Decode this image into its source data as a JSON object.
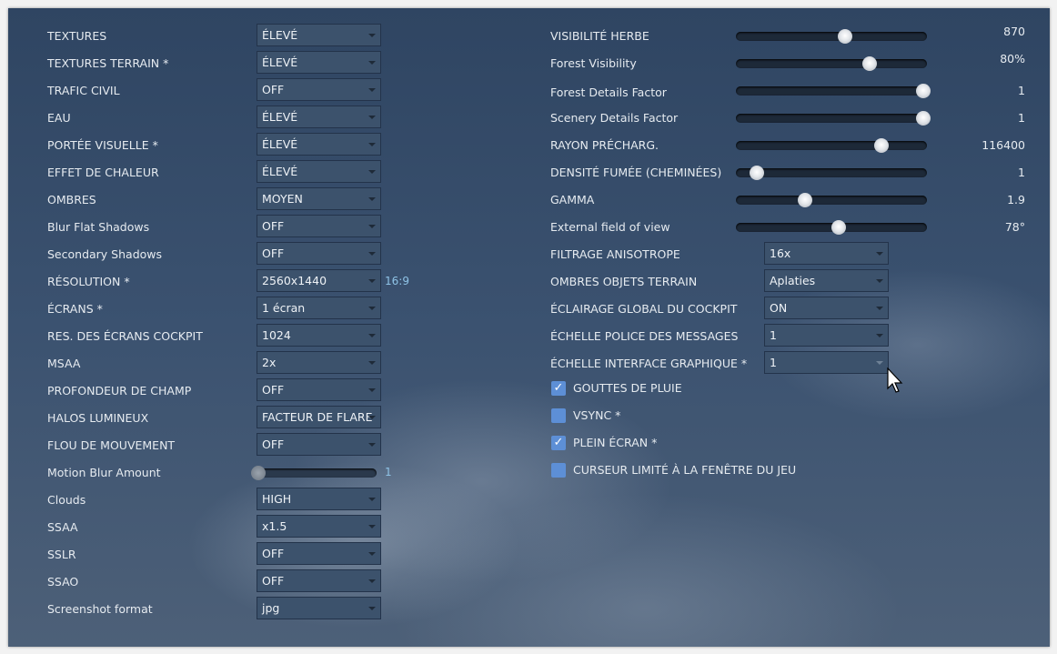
{
  "left_settings": [
    {
      "label": "TEXTURES",
      "type": "dropdown",
      "value": "ÉLEVÉ"
    },
    {
      "label": "TEXTURES TERRAIN *",
      "type": "dropdown",
      "value": "ÉLEVÉ"
    },
    {
      "label": "TRAFIC CIVIL",
      "type": "dropdown",
      "value": "OFF"
    },
    {
      "label": "EAU",
      "type": "dropdown",
      "value": "ÉLEVÉ"
    },
    {
      "label": "PORTÉE VISUELLE *",
      "type": "dropdown",
      "value": "ÉLEVÉ"
    },
    {
      "label": "EFFET DE CHALEUR",
      "type": "dropdown",
      "value": "ÉLEVÉ"
    },
    {
      "label": "OMBRES",
      "type": "dropdown",
      "value": "MOYEN"
    },
    {
      "label": "Blur Flat Shadows",
      "type": "dropdown",
      "value": "OFF"
    },
    {
      "label": "Secondary Shadows",
      "type": "dropdown",
      "value": "OFF"
    },
    {
      "label": "RÉSOLUTION *",
      "type": "dropdown",
      "value": "2560x1440",
      "extra": "16:9"
    },
    {
      "label": "ÉCRANS *",
      "type": "dropdown",
      "value": "1 écran"
    },
    {
      "label": "RES. DES ÉCRANS COCKPIT",
      "type": "dropdown",
      "value": "1024"
    },
    {
      "label": "MSAA",
      "type": "dropdown",
      "value": "2x"
    },
    {
      "label": "PROFONDEUR DE CHAMP",
      "type": "dropdown",
      "value": "OFF"
    },
    {
      "label": "HALOS LUMINEUX",
      "type": "dropdown",
      "value": "FACTEUR DE FLARE"
    },
    {
      "label": "FLOU DE MOUVEMENT",
      "type": "dropdown",
      "value": "OFF"
    },
    {
      "label": "Motion Blur Amount",
      "type": "slider",
      "value": "1",
      "fraction": 0.0
    },
    {
      "label": "Clouds",
      "type": "dropdown",
      "value": "HIGH"
    },
    {
      "label": "SSAA",
      "type": "dropdown",
      "value": "x1.5"
    },
    {
      "label": "SSLR",
      "type": "dropdown",
      "value": "OFF"
    },
    {
      "label": "SSAO",
      "type": "dropdown",
      "value": "OFF"
    },
    {
      "label": "Screenshot format",
      "type": "dropdown",
      "value": "jpg"
    }
  ],
  "right_sliders": [
    {
      "label": "VISIBILITÉ HERBE",
      "value": "870",
      "fraction": 0.57
    },
    {
      "label": "Forest Visibility",
      "value": "80%",
      "fraction": 0.7
    },
    {
      "label": "Forest Details Factor",
      "value": "1",
      "fraction": 0.98
    },
    {
      "label": "Scenery Details Factor",
      "value": "1",
      "fraction": 0.98
    },
    {
      "label": "RAYON PRÉCHARG.",
      "value": "116400",
      "fraction": 0.76
    },
    {
      "label": "DENSITÉ FUMÉE (CHEMINÉES)",
      "value": "1",
      "fraction": 0.11
    },
    {
      "label": "GAMMA",
      "value": "1.9",
      "fraction": 0.36
    },
    {
      "label": "External field of view",
      "value": "78°",
      "fraction": 0.54
    }
  ],
  "right_dropdowns": [
    {
      "label": "FILTRAGE ANISOTROPE",
      "value": "16x"
    },
    {
      "label": "OMBRES OBJETS TERRAIN",
      "value": "Aplaties"
    },
    {
      "label": "ÉCLAIRAGE GLOBAL DU COCKPIT",
      "value": "ON"
    },
    {
      "label": "ÉCHELLE POLICE DES MESSAGES",
      "value": "1"
    },
    {
      "label": "ÉCHELLE INTERFACE GRAPHIQUE *",
      "value": "1",
      "dim": true
    }
  ],
  "checkboxes": [
    {
      "label": "GOUTTES DE PLUIE",
      "checked": true
    },
    {
      "label": "VSYNC *",
      "checked": false
    },
    {
      "label": "PLEIN ÉCRAN *",
      "checked": true
    },
    {
      "label": "CURSEUR LIMITÉ À LA FENÊTRE DU JEU",
      "checked": false
    }
  ],
  "colors": {
    "accent": "#5d8fd6",
    "aspect_text": "#8fc3e6"
  },
  "icons": {
    "dropdown": "caret-down-icon",
    "check": "checkmark-icon",
    "cursor": "mouse-pointer-icon"
  }
}
